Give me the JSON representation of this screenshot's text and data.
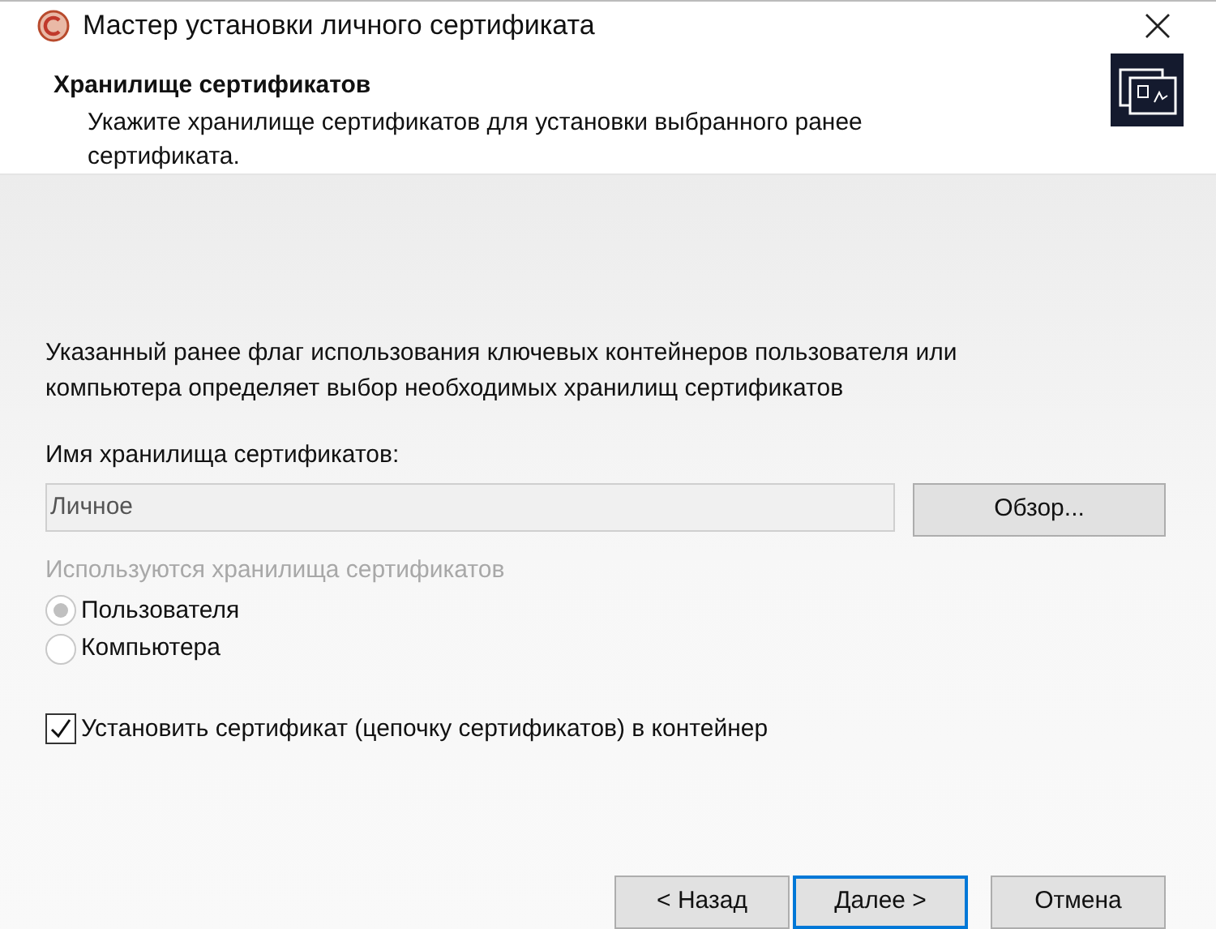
{
  "window": {
    "title": "Мастер установки личного сертификата"
  },
  "header": {
    "title": "Хранилище сертификатов",
    "subtitle": "Укажите хранилище сертификатов для установки выбранного ранее сертификата."
  },
  "description": "Указанный ранее флаг использования ключевых контейнеров пользователя или компьютера определяет выбор необходимых хранилищ сертификатов",
  "store_field": {
    "label": "Имя хранилища сертификатов:",
    "value": "Личное",
    "disabled": true
  },
  "browse_button": "Обзор...",
  "store_type": {
    "label": "Используются хранилища сертификатов",
    "disabled": true,
    "options": [
      {
        "label": "Пользователя",
        "selected": true
      },
      {
        "label": "Компьютера",
        "selected": false
      }
    ]
  },
  "install_checkbox": {
    "label": "Установить сертификат (цепочку сертификатов) в контейнер",
    "checked": true
  },
  "buttons": [
    {
      "label": "< Назад",
      "focused": false
    },
    {
      "label": "Далее >",
      "focused": true
    },
    {
      "label": "Отмена",
      "focused": false
    }
  ]
}
